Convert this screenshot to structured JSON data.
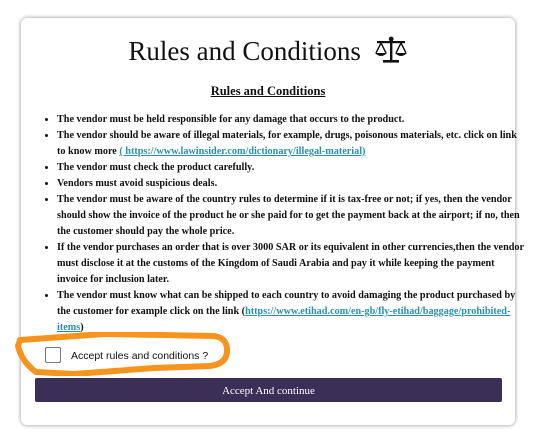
{
  "header": {
    "title": "Rules and Conditions",
    "icon": "balance-scale-icon"
  },
  "subtitle": "Rules and Conditions",
  "rules": [
    {
      "text": "The vendor must be held responsible for any damage that occurs to the product."
    },
    {
      "text": "The vendor should be aware of illegal materials, for example, drugs, poisonous materials, etc. click on link to know more ",
      "link": "( https://www.lawinsider.com/dictionary/illegal-material)"
    },
    {
      "text": "The vendor must check the product carefully."
    },
    {
      "text": "Vendors must avoid suspicious deals."
    },
    {
      "text": " The vendor must be aware of the country rules to determine if it is tax-free or not; if yes, then the vendor should show the invoice of the product he or she paid for to get the payment back at the airport; if no, then the customer should pay the whole price."
    },
    {
      "text": "If the vendor purchases an order that is over 3000 SAR or its equivalent in other currencies,then the vendor must disclose it at the customs of the Kingdom of Saudi Arabia and pay it while keeping the payment invoice for inclusion later."
    },
    {
      "text": "The vendor must know what can be shipped to each country to avoid damaging the product purchased by the customer for example click on the link (",
      "link": "https://www.etihad.com/en-gb/fly-etihad/baggage/prohibited-items",
      "after": ")"
    }
  ],
  "accept": {
    "label": "Accept rules and conditions ?",
    "checked": false
  },
  "continue_button": {
    "label": "Accept And continue"
  },
  "colors": {
    "button_bg": "#3c2f57",
    "link": "#2a8fb0",
    "highlight": "#f7941d"
  }
}
